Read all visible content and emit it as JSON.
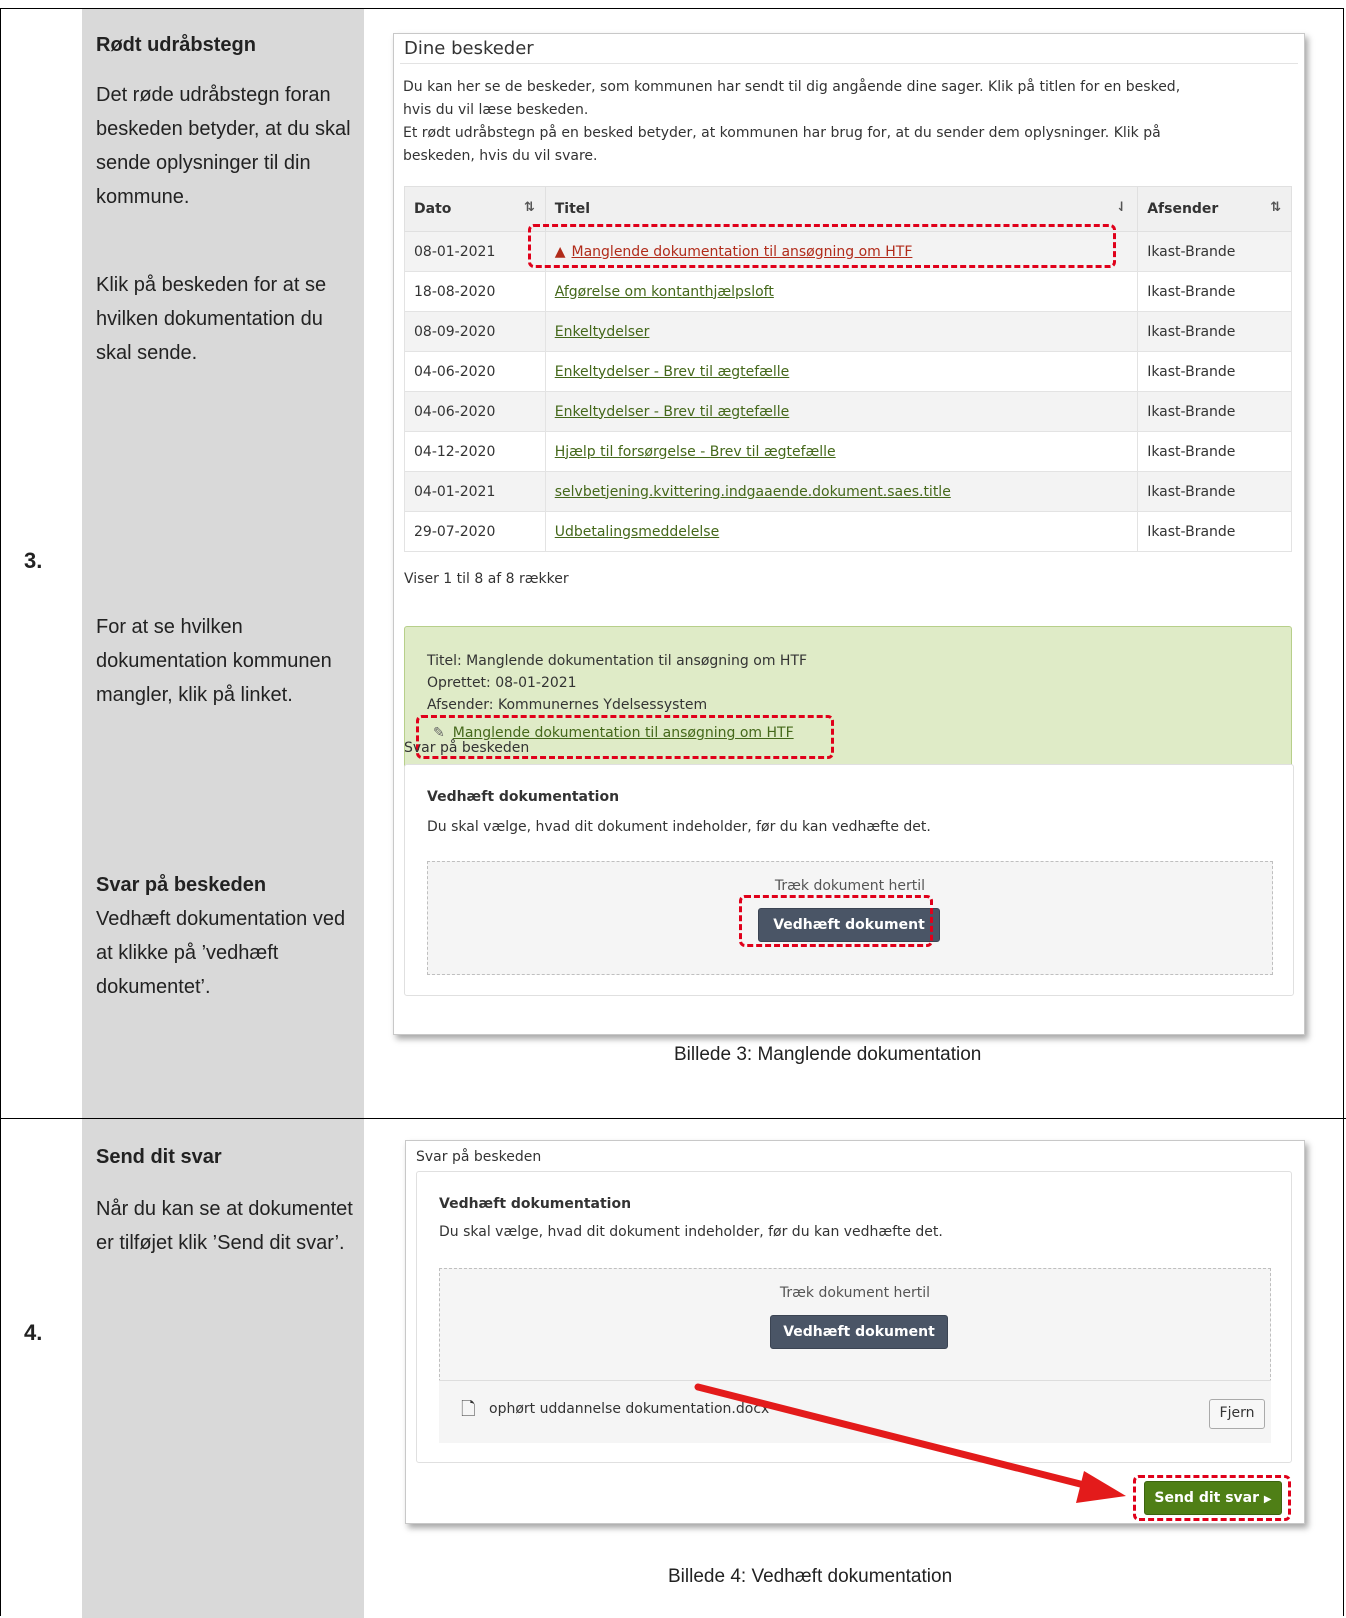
{
  "step3": {
    "number": "3.",
    "heading1": "Rødt udråbstegn",
    "para1": "Det røde udråbstegn foran beskeden betyder, at du skal sende oplysninger til din kommune.",
    "para2": "Klik på beskeden for at se hvilken dokumentation du skal sende.",
    "para3": "For at se hvilken dokumentation kommunen mangler, klik på linket.",
    "heading2": "Svar på beskeden",
    "para4": "Vedhæft dokumentation ved at klikke på ’vedhæft dokumentet’.",
    "caption": "Billede 3: Manglende dokumentation"
  },
  "screenshot3": {
    "title": "Dine beskeder",
    "intro_line1": "Du kan her se de beskeder, som kommunen har sendt til dig angående dine sager. Klik på titlen for en besked,",
    "intro_line2": "hvis du vil læse beskeden.",
    "intro_line3": "Et rødt udråbstegn på en besked betyder, at kommunen har brug for, at du sender dem oplysninger. Klik på",
    "intro_line4": "beskeden, hvis du vil svare.",
    "columns": [
      "Dato",
      "Titel",
      "Afsender"
    ],
    "sort_icons": [
      "⇅",
      "⇃",
      "⇅"
    ],
    "rows": [
      {
        "date": "08-01-2021",
        "title": "Manglende dokumentation til ansøgning om HTF",
        "sender": "Ikast-Brande",
        "warning": true
      },
      {
        "date": "18-08-2020",
        "title": "Afgørelse om kontanthjælpsloft",
        "sender": "Ikast-Brande",
        "warning": false
      },
      {
        "date": "08-09-2020",
        "title": "Enkeltydelser",
        "sender": "Ikast-Brande",
        "warning": false
      },
      {
        "date": "04-06-2020",
        "title": "Enkeltydelser - Brev til ægtefælle",
        "sender": "Ikast-Brande",
        "warning": false
      },
      {
        "date": "04-06-2020",
        "title": "Enkeltydelser - Brev til ægtefælle",
        "sender": "Ikast-Brande",
        "warning": false
      },
      {
        "date": "04-12-2020",
        "title": "Hjælp til forsørgelse - Brev til ægtefælle",
        "sender": "Ikast-Brande",
        "warning": false
      },
      {
        "date": "04-01-2021",
        "title": "selvbetjening.kvittering.indgaaende.dokument.saes.title",
        "sender": "Ikast-Brande",
        "warning": false
      },
      {
        "date": "29-07-2020",
        "title": "Udbetalingsmeddelelse",
        "sender": "Ikast-Brande",
        "warning": false
      }
    ],
    "row_count": "Viser 1 til 8 af 8 rækker",
    "detail": {
      "title_line": "Titel: Manglende dokumentation til ansøgning om HTF",
      "created_line": "Oprettet: 08-01-2021",
      "sender_line": "Afsender: Kommunernes Ydelsessystem",
      "attachment_link": "Manglende dokumentation til ansøgning om HTF"
    },
    "reply_label": "Svar på beskeden",
    "attach_heading": "Vedhæft dokumentation",
    "attach_text": "Du skal vælge, hvad dit dokument indeholder, før du kan vedhæfte det.",
    "drop_text": "Træk dokument hertil",
    "attach_button": "Vedhæft dokument"
  },
  "step4": {
    "number": "4.",
    "heading": "Send dit svar",
    "para": "Når du kan se at dokumentet er tilføjet klik ’Send dit svar’.",
    "caption": "Billede 4: Vedhæft dokumentation"
  },
  "screenshot4": {
    "reply_label": "Svar på beskeden",
    "attach_heading": "Vedhæft dokumentation",
    "attach_text": "Du skal vælge, hvad dit dokument indeholder, før du kan vedhæfte det.",
    "drop_text": "Træk dokument hertil",
    "attach_button": "Vedhæft dokument",
    "file_name": "ophørt uddannelse dokumentation.docx",
    "remove_button": "Fjern",
    "send_button": "Send dit svar"
  },
  "colors": {
    "highlight": "#e0001a",
    "link_green": "#44681a",
    "warning_red": "#b12b1a",
    "send_green": "#4f7f16"
  }
}
